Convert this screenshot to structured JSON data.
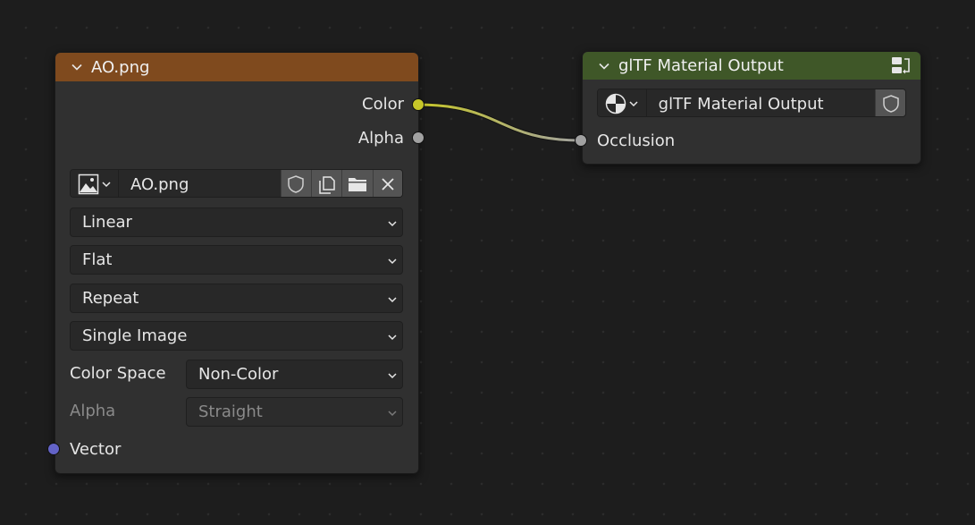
{
  "image_node": {
    "title": "AO.png",
    "header_color": "#7f4a1e",
    "outputs": [
      {
        "label": "Color",
        "socket_color": "#c7c729"
      },
      {
        "label": "Alpha",
        "socket_color": "#a1a1a1"
      }
    ],
    "image_field": {
      "value": "AO.png",
      "icon": "image-icon"
    },
    "interpolation": "Linear",
    "projection": "Flat",
    "extension": "Repeat",
    "source": "Single Image",
    "color_space": {
      "label": "Color Space",
      "value": "Non-Color"
    },
    "alpha": {
      "label": "Alpha",
      "value": "Straight"
    },
    "inputs": [
      {
        "label": "Vector",
        "socket_color": "#6363c7"
      }
    ]
  },
  "output_node": {
    "title": "glTF Material Output",
    "header_color": "#3f5728",
    "node_group_field": {
      "value": "glTF Material Output",
      "icon": "node-tree-icon"
    },
    "inputs": [
      {
        "label": "Occlusion",
        "socket_color": "#a1a1a1"
      }
    ]
  },
  "link": {
    "from": "Color",
    "to": "Occlusion",
    "start_color": "#c7c729",
    "end_color": "#a1a1a1"
  }
}
